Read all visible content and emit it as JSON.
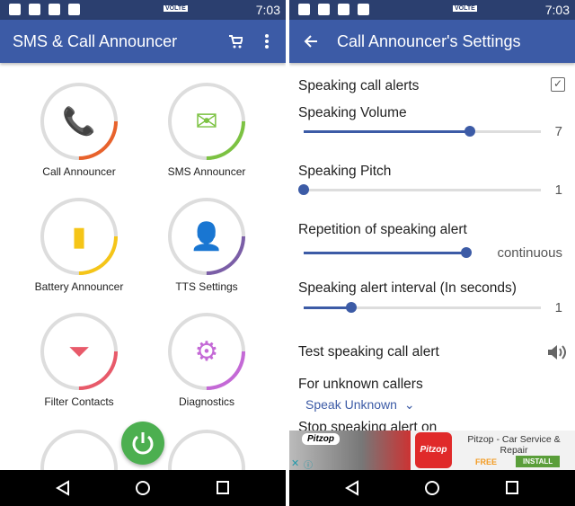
{
  "status": {
    "time": "7:03",
    "volte": "VOLTE"
  },
  "left": {
    "title": "SMS & Call Announcer",
    "tiles": [
      {
        "label": "Call Announcer",
        "icon": "phone-icon",
        "color": "#e8622c"
      },
      {
        "label": "SMS Announcer",
        "icon": "envelope-icon",
        "color": "#7cc242"
      },
      {
        "label": "Battery Announcer",
        "icon": "battery-icon",
        "color": "#f5c518"
      },
      {
        "label": "TTS Settings",
        "icon": "speaking-head-icon",
        "color": "#7b5ea7"
      },
      {
        "label": "Filter Contacts",
        "icon": "funnel-icon",
        "color": "#e85a6a"
      },
      {
        "label": "Diagnostics",
        "icon": "magnifier-gear-icon",
        "color": "#c469d6"
      }
    ]
  },
  "right": {
    "title": "Call Announcer's Settings",
    "speaking_call_alerts": "Speaking call alerts",
    "speaking_call_alerts_checked": true,
    "volume": {
      "label": "Speaking Volume",
      "value": "7",
      "fraction": 0.7
    },
    "pitch": {
      "label": "Speaking Pitch",
      "value": "1",
      "fraction": 0.0
    },
    "repetition": {
      "label": "Repetition of speaking alert",
      "value": "continuous",
      "fraction": 1.0
    },
    "interval": {
      "label": "Speaking alert interval (In seconds)",
      "value": "1",
      "fraction": 0.2
    },
    "test": "Test speaking call alert",
    "unknown": {
      "label": "For unknown callers",
      "value": "Speak Unknown"
    },
    "stop": "Stop speaking alert on"
  },
  "ad": {
    "brand": "Pitzop",
    "title": "Pitzop - Car Service & Repair",
    "price": "FREE",
    "install": "INSTALL"
  },
  "colors": {
    "primary": "#3c5ba6",
    "status": "#2b3f6f",
    "fab": "#4caf50"
  }
}
